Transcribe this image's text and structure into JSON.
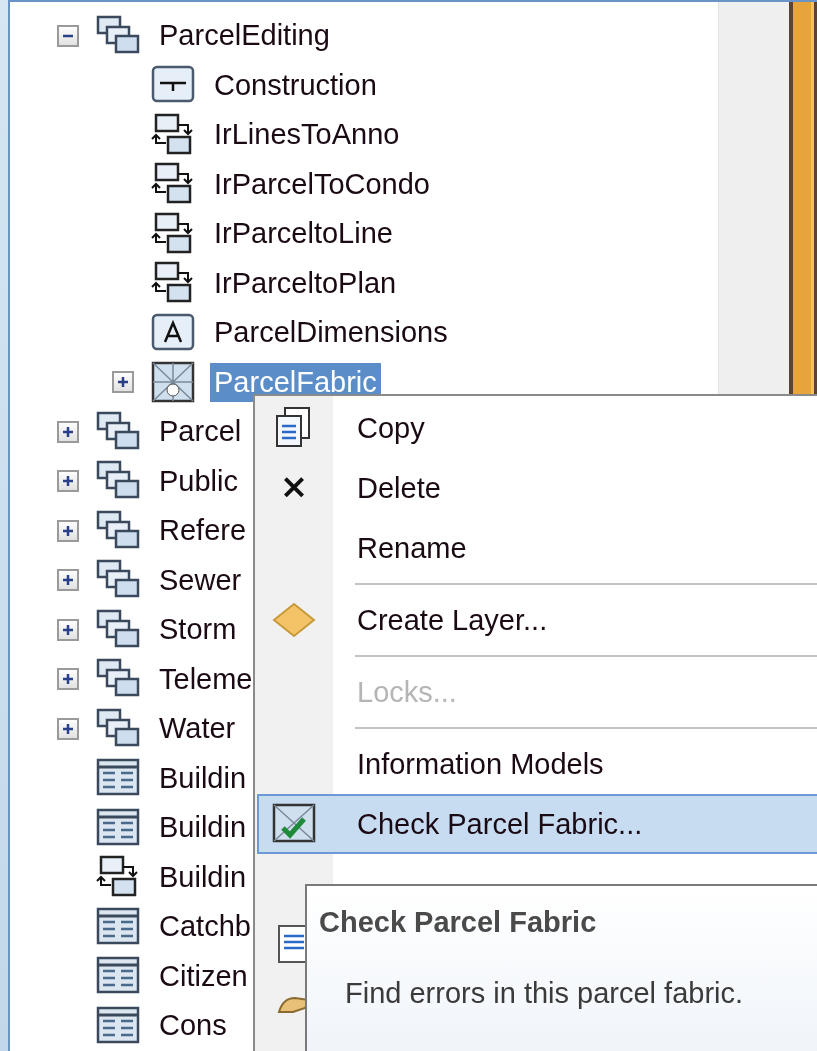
{
  "tree": [
    {
      "label": "ParcelEditing",
      "kind": "dataset",
      "expanded": true,
      "selected": false,
      "children": [
        {
          "label": "Construction",
          "kind": "construction",
          "selected": false
        },
        {
          "label": "IrLinesToAnno",
          "kind": "relationship",
          "selected": false
        },
        {
          "label": "IrParcelToCondo",
          "kind": "relationship",
          "selected": false
        },
        {
          "label": "IrParceltoLine",
          "kind": "relationship",
          "selected": false
        },
        {
          "label": "IrParceltoPlan",
          "kind": "relationship",
          "selected": false
        },
        {
          "label": "ParcelDimensions",
          "kind": "annotation",
          "selected": false
        },
        {
          "label": "ParcelFabric",
          "kind": "fabric",
          "expanded": false,
          "selected": true
        }
      ]
    },
    {
      "label": "Parcel",
      "kind": "dataset",
      "expanded": false,
      "selected": false
    },
    {
      "label": "Public",
      "kind": "dataset",
      "expanded": false,
      "selected": false
    },
    {
      "label": "Refere",
      "kind": "dataset",
      "expanded": false,
      "selected": false
    },
    {
      "label": "Sewer",
      "kind": "dataset",
      "expanded": false,
      "selected": false
    },
    {
      "label": "Storm",
      "kind": "dataset",
      "expanded": false,
      "selected": false
    },
    {
      "label": "Teleme",
      "kind": "dataset",
      "expanded": false,
      "selected": false
    },
    {
      "label": "Water",
      "kind": "dataset",
      "expanded": false,
      "selected": false
    },
    {
      "label": "Buildin",
      "kind": "table",
      "selected": false
    },
    {
      "label": "Buildin",
      "kind": "table",
      "selected": false
    },
    {
      "label": "Buildin",
      "kind": "relationship",
      "selected": false
    },
    {
      "label": "Catchb",
      "kind": "table",
      "selected": false
    },
    {
      "label": "Citizen",
      "kind": "table",
      "selected": false
    },
    {
      "label": "Cons",
      "kind": "table",
      "selected": false
    }
  ],
  "context_menu": [
    {
      "kind": "copy",
      "label": "Copy",
      "disabled": false,
      "selected": false
    },
    {
      "kind": "delete",
      "label": "Delete",
      "disabled": false,
      "selected": false
    },
    {
      "kind": "plain",
      "label": "Rename",
      "disabled": false,
      "selected": false
    },
    {
      "kind": "separator"
    },
    {
      "kind": "layer",
      "label": "Create Layer...",
      "disabled": false,
      "selected": false
    },
    {
      "kind": "separator"
    },
    {
      "kind": "plain",
      "label": "Locks...",
      "disabled": true,
      "selected": false
    },
    {
      "kind": "separator"
    },
    {
      "kind": "plain",
      "label": "Information Models",
      "disabled": false,
      "selected": false
    },
    {
      "kind": "check",
      "label": "Check Parcel Fabric...",
      "disabled": false,
      "selected": true
    },
    {
      "kind": "plain",
      "selected": false
    },
    {
      "kind": "document",
      "selected": false
    },
    {
      "kind": "hand",
      "selected": false
    }
  ],
  "tooltip": {
    "title": "Check Parcel Fabric",
    "description": "Find errors in this parcel fabric."
  }
}
